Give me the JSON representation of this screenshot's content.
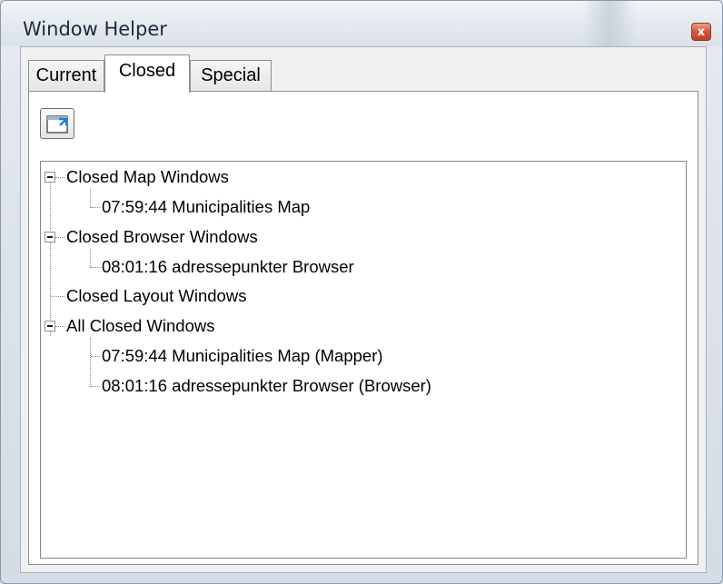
{
  "window": {
    "title": "Window Helper",
    "close_glyph": "x"
  },
  "tabs": [
    {
      "label": "Current",
      "active": false
    },
    {
      "label": "Closed",
      "active": true
    },
    {
      "label": "Special",
      "active": false
    }
  ],
  "toolbar": {
    "restore_icon": "restore-window-icon"
  },
  "tree": {
    "groups": [
      {
        "label": "Closed Map Windows",
        "expanded": true,
        "children": [
          "07:59:44 Municipalities Map"
        ]
      },
      {
        "label": "Closed Browser Windows",
        "expanded": true,
        "children": [
          "08:01:16 adressepunkter Browser"
        ]
      },
      {
        "label": "Closed Layout Windows",
        "expanded": false,
        "children": []
      },
      {
        "label": "All Closed Windows",
        "expanded": true,
        "children": [
          "07:59:44 Municipalities Map (Mapper)",
          "08:01:16 adressepunkter Browser (Browser)"
        ]
      }
    ]
  },
  "colors": {
    "close_button": "#c94a33",
    "tree_lines": "#8a8a8a"
  }
}
